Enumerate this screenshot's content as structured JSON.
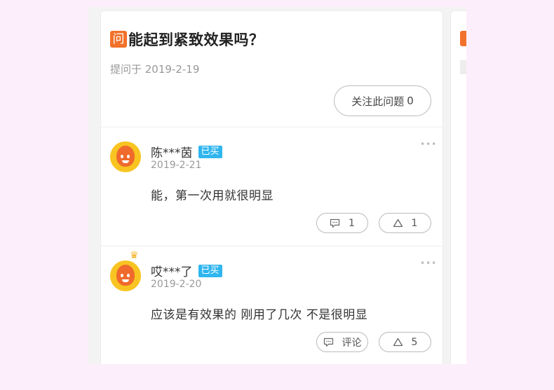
{
  "question": {
    "badge": "问",
    "title": "能起到紧致效果吗？",
    "asked_date": "提问于 2019-2-19",
    "follow_label": "关注此问题",
    "follow_count": "0"
  },
  "peek_card": {
    "badge": "问"
  },
  "answers": [
    {
      "user": "陈***茵",
      "badge": "已买",
      "date": "2019-2-21",
      "content": "能，第一次用就很明显",
      "more": "•••",
      "comment_label": "1",
      "like_count": "1",
      "crown": false
    },
    {
      "user": "哎***了",
      "badge": "已买",
      "date": "2019-2-20",
      "content": "应该是有效果的 刚用了几次 不是很明显",
      "more": "•••",
      "comment_label": "评论",
      "like_count": "5",
      "crown": true
    }
  ],
  "colors": {
    "background": "#fdeefb",
    "question_badge": "#f2712b",
    "bought_badge": "#2fb6ef",
    "avatar_bg": "#f8c421",
    "avatar_face": "#ef6a2c"
  },
  "icons": [
    "comment-icon",
    "like-icon",
    "more-icon",
    "crown-icon"
  ]
}
